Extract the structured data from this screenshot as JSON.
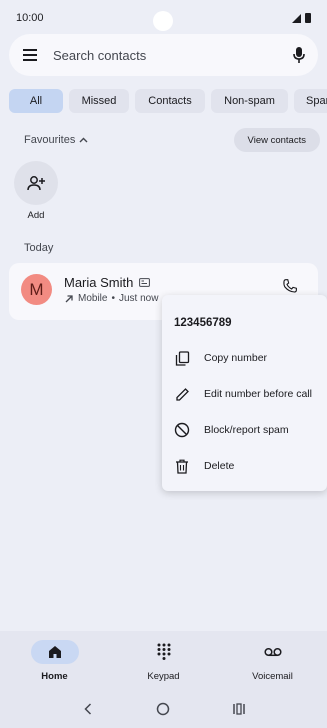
{
  "status_bar": {
    "time": "10:00"
  },
  "search": {
    "placeholder": "Search contacts"
  },
  "chips": [
    {
      "label": "All",
      "active": true
    },
    {
      "label": "Missed"
    },
    {
      "label": "Contacts"
    },
    {
      "label": "Non-spam"
    },
    {
      "label": "Spam"
    }
  ],
  "favourites": {
    "label": "Favourites",
    "view_contacts_label": "View contacts",
    "add_label": "Add"
  },
  "section_today": "Today",
  "call": {
    "avatar_letter": "M",
    "name": "Maria Smith",
    "type": "Mobile",
    "separator": "•",
    "time": "Just now"
  },
  "context_menu": {
    "number": "123456789",
    "items": [
      {
        "label": "Copy number",
        "icon": "copy-icon"
      },
      {
        "label": "Edit number before call",
        "icon": "edit-icon"
      },
      {
        "label": "Block/report spam",
        "icon": "block-icon"
      },
      {
        "label": "Delete",
        "icon": "trash-icon"
      }
    ]
  },
  "bottom_nav": [
    {
      "label": "Home",
      "icon": "home-icon",
      "active": true
    },
    {
      "label": "Keypad",
      "icon": "keypad-icon"
    },
    {
      "label": "Voicemail",
      "icon": "voicemail-icon"
    }
  ],
  "colors": {
    "background": "#eceef6",
    "active_chip": "#c4d5f2",
    "avatar": "#f28b82",
    "nav_active": "#c9d8f3"
  }
}
